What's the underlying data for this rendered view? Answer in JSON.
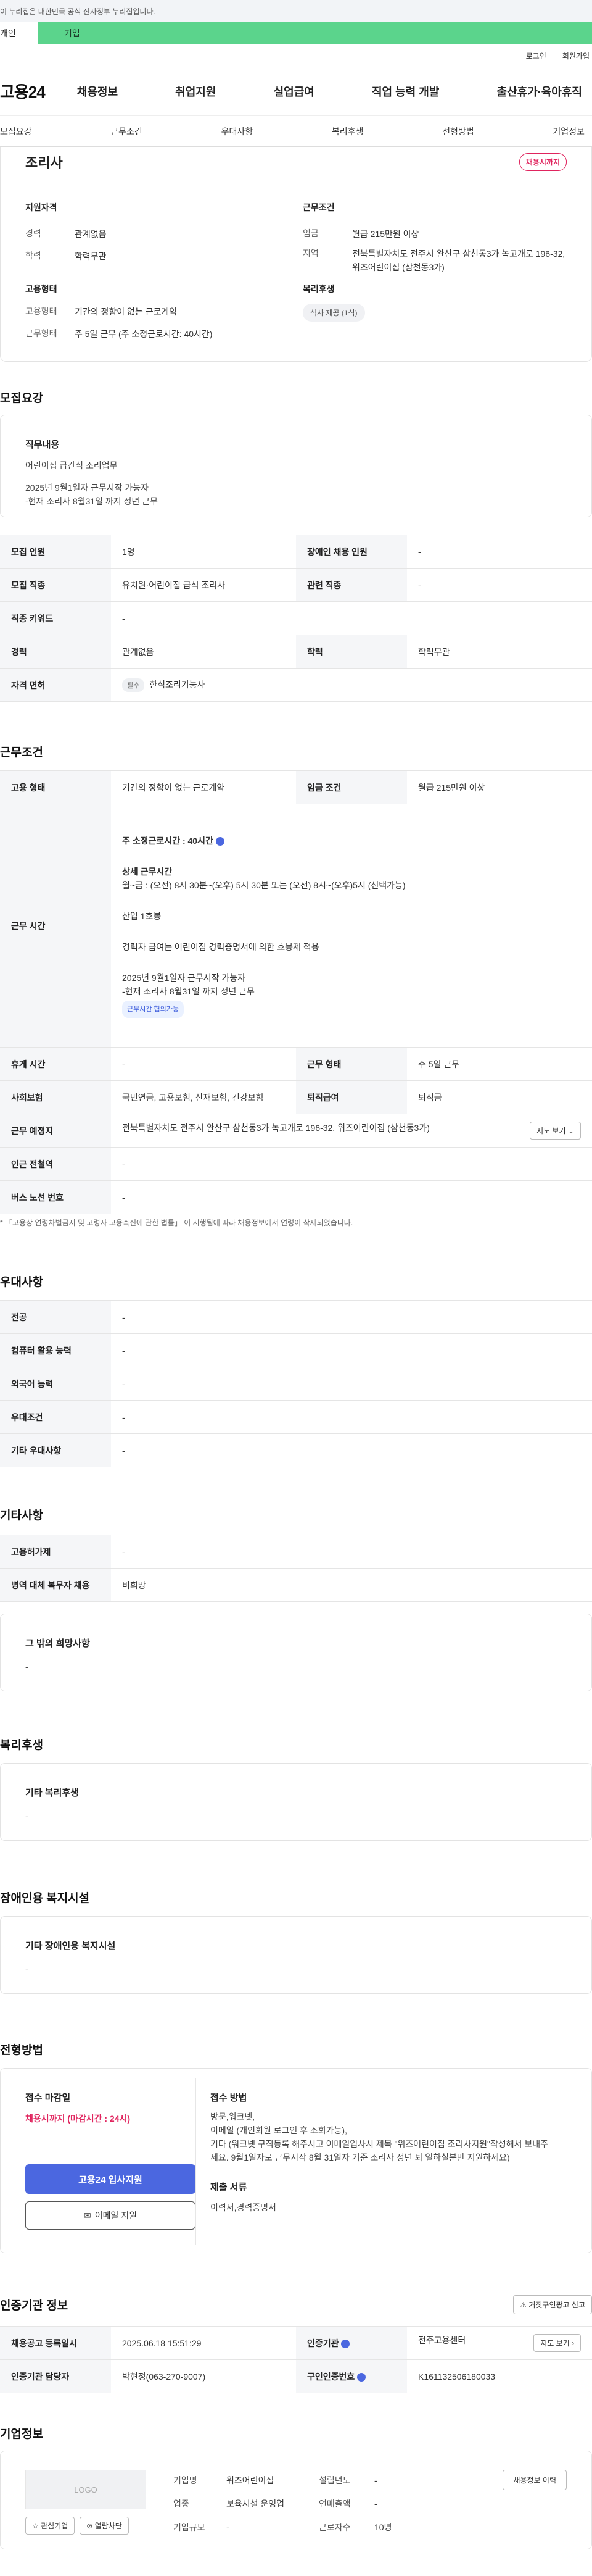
{
  "top": {
    "gov_notice": "이 누리집은 대한민국 공식 전자정부 누리집입니다.",
    "tab_person": "개인",
    "tab_company": "기업",
    "login": "로그인",
    "signup": "회원가입"
  },
  "gnb": {
    "logo": "고용24",
    "menu": [
      "채용정보",
      "취업지원",
      "실업급여",
      "직업 능력 개발",
      "출산휴가·육아휴직"
    ]
  },
  "subnav": [
    "모집요강",
    "근무조건",
    "우대사항",
    "복리후생",
    "전형방법",
    "기업정보"
  ],
  "summary": {
    "title": "조리사",
    "badge": "채용시까지",
    "qual_title": "지원자격",
    "career_k": "경력",
    "career_v": "관계없음",
    "edu_k": "학력",
    "edu_v": "학력무관",
    "emp_title": "고용형태",
    "emptype_k": "고용형태",
    "emptype_v": "기간의 정함이 없는 근로계약",
    "worktype_k": "근무형태",
    "worktype_v": "주 5일 근무 (주 소정근로시간: 40시간)",
    "cond_title": "근무조건",
    "wage_k": "임금",
    "wage_v": "월급 215만원 이상",
    "area_k": "지역",
    "area_v": "전북특별자치도 전주시 완산구 삼천동3가 녹고개로 196-32, 위즈어린이집 (삼천동3가)",
    "welfare_title": "복리후생",
    "welfare_pill": "식사 제공 (1식)"
  },
  "recruit": {
    "section": "모집요강",
    "job_title": "직무내용",
    "job_lines": [
      "어린이집 급간식 조리업무",
      "",
      "2025년 9월1일자 근무시작 가능자",
      "-현재 조리사 8월31일 까지 정년 근무"
    ],
    "rows": [
      {
        "k1": "모집 인원",
        "v1": "1명",
        "k2": "장애인 채용 인원",
        "v2": "-"
      },
      {
        "k1": "모집 직종",
        "v1": "유치원·어린이집 급식 조리사",
        "k2": "관련 직종",
        "v2": "-"
      },
      {
        "k1": "직종 키워드",
        "v1": "-"
      },
      {
        "k1": "경력",
        "v1": "관계없음",
        "k2": "학력",
        "v2": "학력무관"
      }
    ],
    "license_k": "자격 면허",
    "license_tag": "필수",
    "license_v": "한식조리기능사"
  },
  "work": {
    "section": "근무조건",
    "emptype_k": "고용 형태",
    "emptype_v": "기간의 정함이 없는 근로계약",
    "wage_k": "임금 조건",
    "wage_v": "월급 215만원 이상",
    "hours_k": "근무 시간",
    "hours_weekly": "주 소정근로시간 : 40시간",
    "hours_detail_title": "상세 근무시간",
    "hours_detail": "월~금 : (오전) 8시 30분~(오후) 5시 30분 또는 (오전) 8시~(오후)5시 (선택가능)",
    "hours_l1": "산입 1호봉",
    "hours_l2": "경력자 급여는 어린이집 경력증명서에 의한 호봉제 적용",
    "hours_l3": "2025년 9월1일자 근무시작 가능자",
    "hours_l4": "-현재 조리사 8월31일 까지 정년 근무",
    "hours_tag": "근무시간 협의가능",
    "rest_k": "휴게 시간",
    "rest_v": "-",
    "form_k": "근무 형태",
    "form_v": "주 5일 근무",
    "insurance_k": "사회보험",
    "insurance_v": "국민연금, 고용보험, 산재보험, 건강보험",
    "retire_k": "퇴직급여",
    "retire_v": "퇴직금",
    "place_k": "근무 예정지",
    "place_v": "전북특별자치도 전주시 완산구 삼천동3가 녹고개로 196-32, 위즈어린이집 (삼천동3가)",
    "map_btn": "지도 보기",
    "subway_k": "인근 전철역",
    "subway_v": "-",
    "bus_k": "버스 노선 번호",
    "bus_v": "-",
    "note": "* 「고용상 연령차별금지 및 고령자 고용촉진에 관한 법률」 이 시행됨에 따라 채용정보에서 연령이 삭제되었습니다."
  },
  "pref": {
    "section": "우대사항",
    "rows": [
      {
        "k": "전공",
        "v": "-"
      },
      {
        "k": "컴퓨터 활용 능력",
        "v": "-"
      },
      {
        "k": "외국어 능력",
        "v": "-"
      },
      {
        "k": "우대조건",
        "v": "-"
      },
      {
        "k": "기타 우대사항",
        "v": "-"
      }
    ]
  },
  "etc": {
    "section": "기타사항",
    "rows": [
      {
        "k": "고용허가제",
        "v": "-"
      },
      {
        "k": "병역 대체 복무자 채용",
        "v": "비희망"
      }
    ],
    "other_title": "그 밖의 희망사항",
    "other_v": "-"
  },
  "welfare": {
    "section": "복리후생",
    "title": "기타 복리후생",
    "value": "-"
  },
  "disabled": {
    "section": "장애인용 복지시설",
    "title": "기타 장애인용 복지시설",
    "value": "-"
  },
  "screening": {
    "section": "전형방법",
    "deadline_title": "접수 마감일",
    "deadline_v": "채용시까지 (마감시간 : 24시)",
    "apply_btn": "고용24 입사지원",
    "email_btn": "이메일 지원",
    "method_title": "접수 방법",
    "method_lines": [
      "방문,워크넷,",
      "이메일 (개인회원 로그인 후 조회가능),",
      "기타 (워크넷 구직등록 해주시고 이메일입사시 제목 \"위즈어린이집 조리사지원\"작성해서 보내주",
      "세요. 9월1일자로  근무시작 8월 31일자 기준 조리사 정년 퇴 일하실분만 지원하세요)"
    ],
    "docs_title": "제출 서류",
    "docs_v": "이력서,경력증명서"
  },
  "cert": {
    "section": "인증기관 정보",
    "report_btn": "거짓구인광고 신고",
    "reg_k": "채용공고 등록일시",
    "reg_v": "2025.06.18 15:51:29",
    "org_k": "인증기관",
    "org_v": "전주고용센터",
    "map_btn": "지도 보기",
    "mgr_k": "인증기관 담당자",
    "mgr_v": "박현정(063-270-9007)",
    "num_k": "구인인증번호",
    "num_v": "K161132506180033"
  },
  "company": {
    "section": "기업정보",
    "logo_text": "LOGO",
    "interest_btn": "관심기업",
    "block_btn": "열람차단",
    "name_k": "기업명",
    "name_v": "위즈어린이집",
    "year_k": "설립년도",
    "year_v": "-",
    "industry_k": "업종",
    "industry_v": "보육시설 운영업",
    "sales_k": "연매출액",
    "sales_v": "-",
    "size_k": "기업규모",
    "size_v": "-",
    "staff_k": "근로자수",
    "staff_v": "10명",
    "view_btn": "채용정보 이력"
  }
}
